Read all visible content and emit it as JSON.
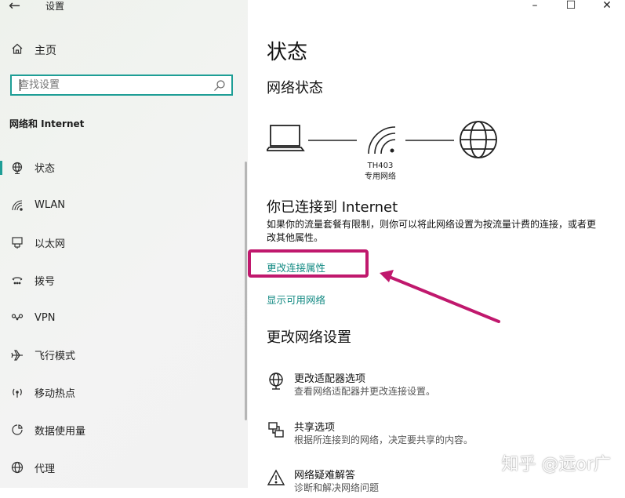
{
  "window": {
    "title": "设置",
    "minimize": "–",
    "maximize": "☐",
    "close": "✕"
  },
  "sidebar": {
    "home_label": "主页",
    "search_placeholder": "查找设置",
    "section_title": "网络和 Internet",
    "items": [
      {
        "label": "状态",
        "icon": "globe-status-icon",
        "active": true
      },
      {
        "label": "WLAN",
        "icon": "wifi-icon"
      },
      {
        "label": "以太网",
        "icon": "ethernet-icon"
      },
      {
        "label": "拨号",
        "icon": "dialup-icon"
      },
      {
        "label": "VPN",
        "icon": "vpn-icon"
      },
      {
        "label": "飞行模式",
        "icon": "airplane-icon"
      },
      {
        "label": "移动热点",
        "icon": "hotspot-icon"
      },
      {
        "label": "数据使用量",
        "icon": "data-usage-icon"
      },
      {
        "label": "代理",
        "icon": "proxy-globe-icon"
      }
    ]
  },
  "main": {
    "page_title": "状态",
    "network_status_title": "网络状态",
    "network_name": "TH403",
    "network_type": "专用网络",
    "connected_title": "你已连接到 Internet",
    "connected_desc": "如果你的流量套餐有限制，则你可以将此网络设置为按流量计费的连接，或者更改其他属性。",
    "link_change_props": "更改连接属性",
    "link_show_networks": "显示可用网络",
    "change_settings_title": "更改网络设置",
    "options": [
      {
        "title": "更改适配器选项",
        "desc": "查看网络适配器并更改连接设置。",
        "icon": "adapter-globe-icon"
      },
      {
        "title": "共享选项",
        "desc": "根据所连接到的网络，决定要共享的内容。",
        "icon": "sharing-icon"
      },
      {
        "title": "网络疑难解答",
        "desc": "诊断和解决网络问题",
        "icon": "warning-icon"
      }
    ]
  },
  "watermark": "知乎 @远or广",
  "colors": {
    "accent": "#1e9e96",
    "link": "#138a83",
    "annotation": "#c0186d"
  }
}
